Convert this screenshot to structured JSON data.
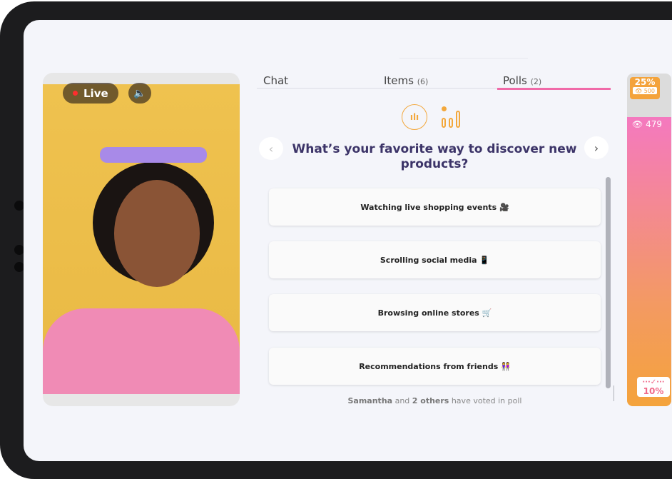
{
  "video": {
    "live_label": "Live",
    "sound_icon": "speaker-icon"
  },
  "tabs": [
    {
      "label": "Chat",
      "count": ""
    },
    {
      "label": "Items",
      "count": "(6)"
    },
    {
      "label": "Polls",
      "count": "(2)"
    }
  ],
  "poll": {
    "question": "What’s your favorite way to discover new products?",
    "options": [
      {
        "label": "Watching live shopping events",
        "emoji": "🎥"
      },
      {
        "label": "Scrolling social media",
        "emoji": "📱"
      },
      {
        "label": "Browsing online stores",
        "emoji": "🛒"
      },
      {
        "label": "Recommendations from friends",
        "emoji": "👭"
      }
    ],
    "voters": {
      "name": "Samantha",
      "middle": " and ",
      "others": "2 others",
      "suffix": " have voted in poll"
    }
  },
  "meter": {
    "top_percent": "25%",
    "top_viewers": "500",
    "current_viewers": "479",
    "bottom_percent": "10%",
    "accent_pink": "#f479bf",
    "accent_orange": "#f4a33b"
  }
}
